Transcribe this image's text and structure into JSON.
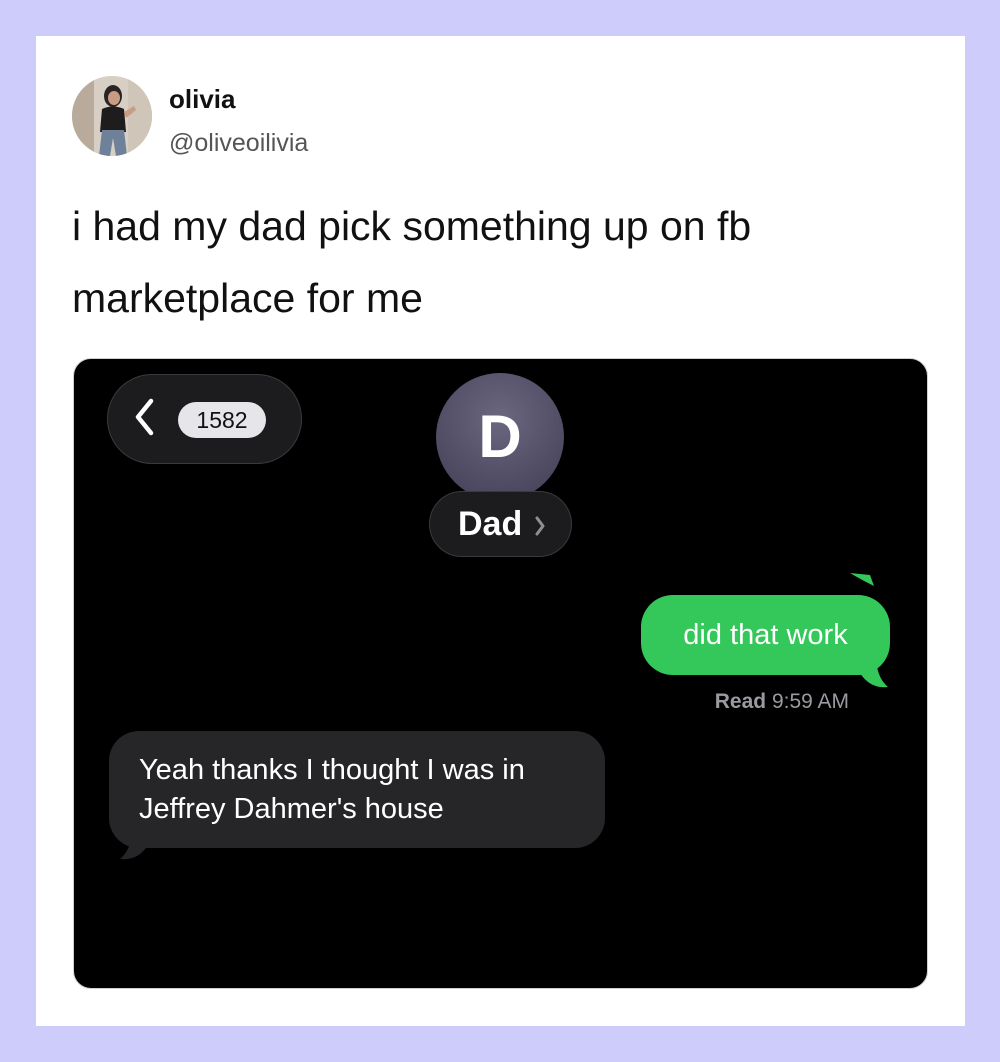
{
  "post": {
    "display_name": "olivia",
    "handle": "@oliveoilivia",
    "text": "i had my dad pick something up on fb marketplace for me"
  },
  "messages_screenshot": {
    "back_icon": "chevron-left-icon",
    "unread_count": "1582",
    "contact_initial": "D",
    "contact_name": "Dad",
    "contact_chevron_icon": "chevron-right-icon",
    "sent_message": "did that work",
    "read_label": "Read",
    "read_time": "9:59 AM",
    "received_message": "Yeah thanks I thought I was in Jeffrey Dahmer's house"
  },
  "colors": {
    "page_background": "#cdccfb",
    "card_background": "#ffffff",
    "sent_bubble": "#34c759",
    "received_bubble": "#262628",
    "screenshot_background": "#000000"
  }
}
